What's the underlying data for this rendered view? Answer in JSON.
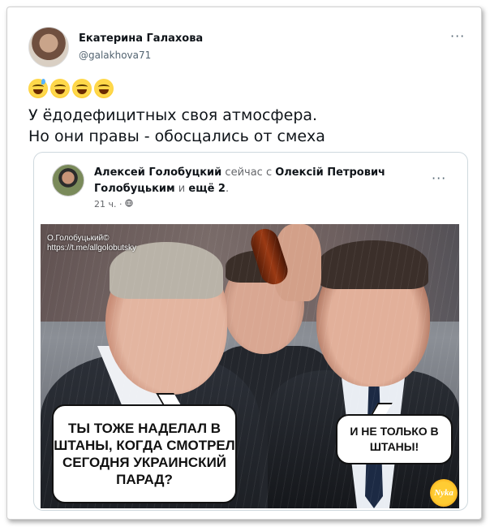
{
  "tweet": {
    "author_name": "Екатерина Галахова",
    "author_handle": "@galakhova71",
    "more_glyph": "···",
    "emojis": [
      "face-with-tears-of-joy-sweat",
      "face-with-tears-of-joy",
      "face-with-tears-of-joy",
      "face-with-tears-of-joy"
    ],
    "text_line1": "У ёдодефицитных своя атмосфера.",
    "text_line2": "Но они правы - обосцались от смеха"
  },
  "quoted_post": {
    "author_name": "Алексей Голобуцкий",
    "with_text": "сейчас с",
    "tagged_name": "Олексій Петрович Голобуцьким",
    "and_text": "и",
    "more_people": "ещё 2",
    "period": ".",
    "time": "21 ч. ·",
    "more_glyph": "···",
    "image": {
      "watermark_line1": "О.Голобуцький©",
      "watermark_line2": "https://t.me/allgolobutsky",
      "bubble_left": "ТЫ ТОЖЕ НАДЕЛАЛ В ШТАНЫ, КОГДА СМОТРЕЛ СЕГОДНЯ УКРАИНСКИЙ ПАРАД?",
      "bubble_right": "И НЕ ТОЛЬКО В ШТАНЫ!",
      "logo_text": "Nyka"
    }
  }
}
